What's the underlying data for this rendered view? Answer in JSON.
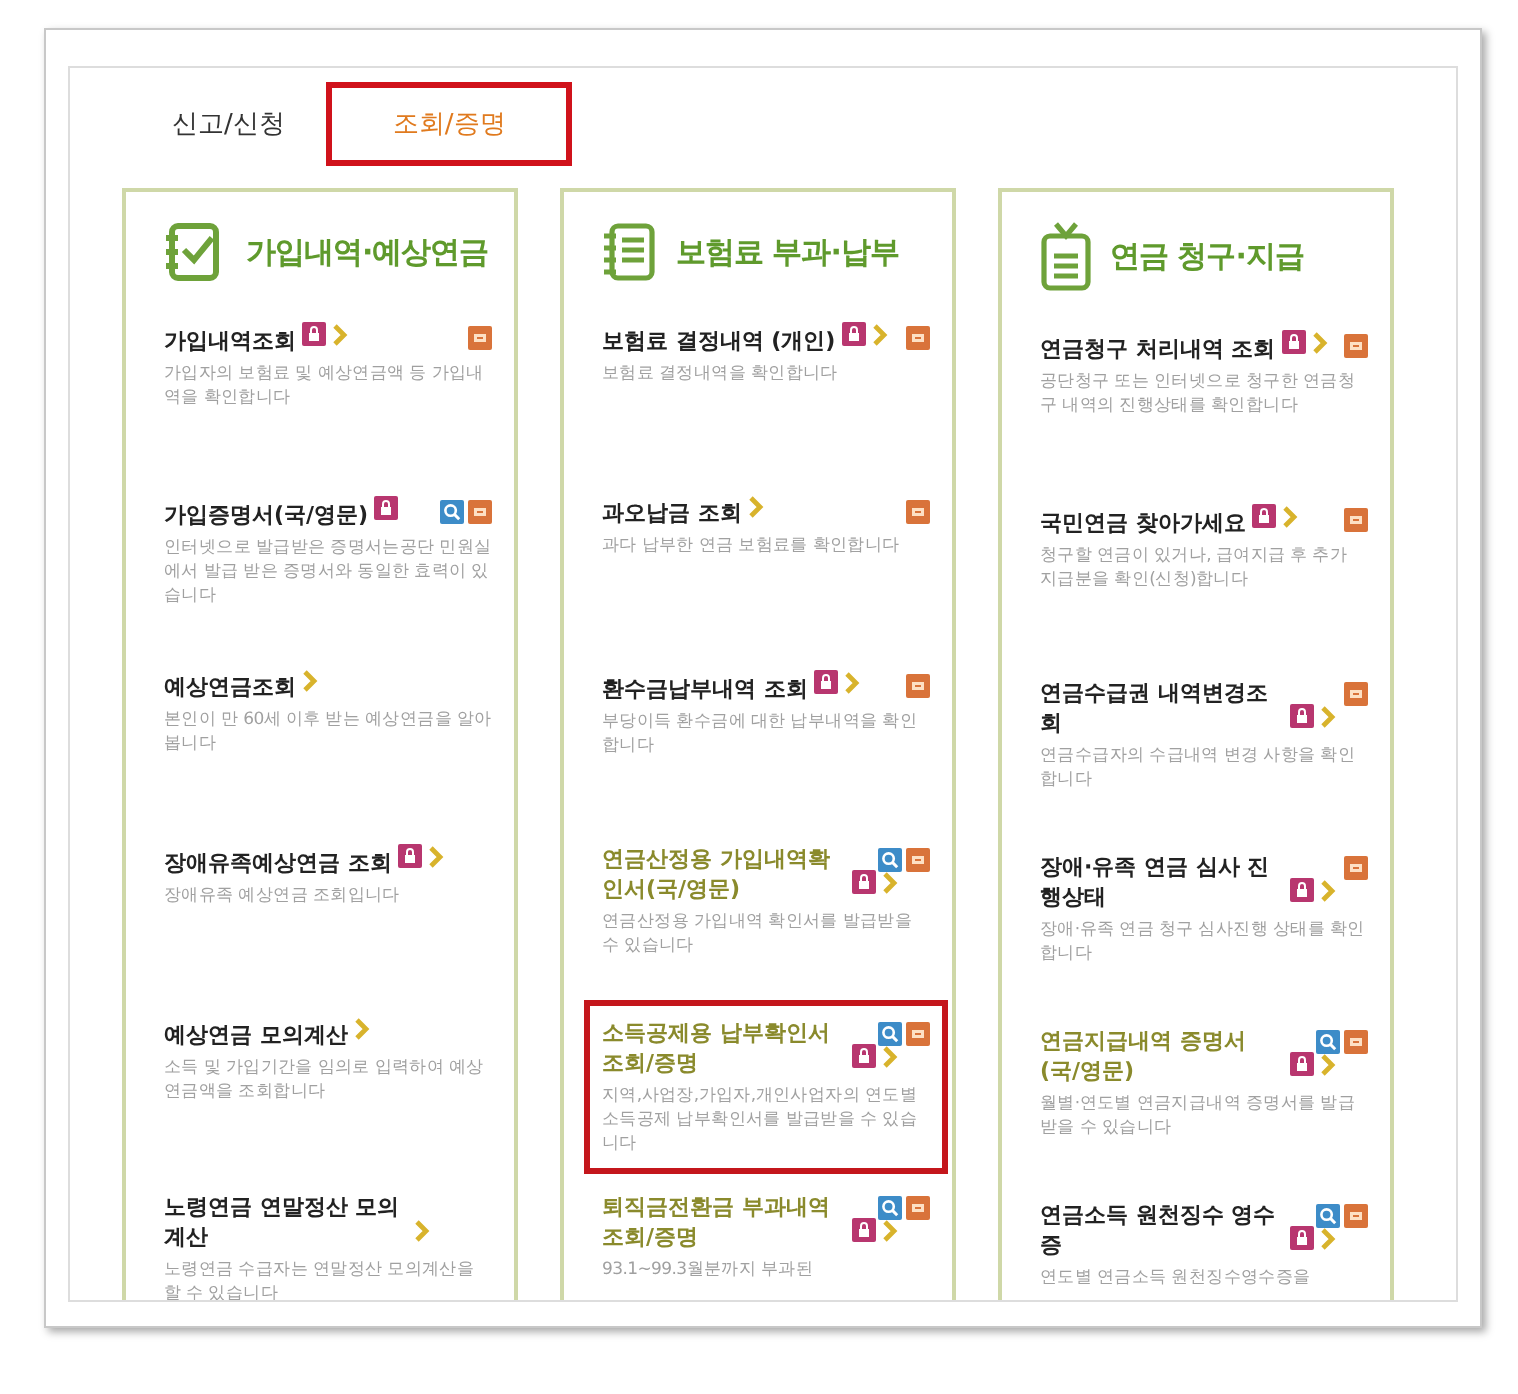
{
  "tabs": [
    {
      "label": "신고/신청",
      "selected": false
    },
    {
      "label": "조회/증명",
      "selected": true
    }
  ],
  "columns": [
    {
      "title": "가입내역·예상연금",
      "kind": "checklist",
      "items": [
        {
          "title": "가입내역조회",
          "description": "가입자의 보험료 및 예상연금액 등 가입내역을 확인합니다",
          "lock": true,
          "arrow": true,
          "search": false,
          "print": true,
          "visited": false,
          "highlighted": false
        },
        {
          "title": "가입증명서(국/영문)",
          "description": "인터넷으로 발급받은 증명서는공단 민원실에서 발급 받은 증명서와 동일한 효력이 있습니다",
          "lock": true,
          "arrow": false,
          "search": true,
          "print": true,
          "visited": false,
          "highlighted": false
        },
        {
          "title": "예상연금조회",
          "description": "본인이 만 60세 이후 받는 예상연금을 알아봅니다",
          "lock": false,
          "arrow": true,
          "search": false,
          "print": false,
          "visited": false,
          "highlighted": false
        },
        {
          "title": "장애유족예상연금 조회",
          "description": "장애유족 예상연금 조회입니다",
          "lock": true,
          "arrow": true,
          "search": false,
          "print": false,
          "visited": false,
          "highlighted": false
        },
        {
          "title": "예상연금 모의계산",
          "description": "소득 및 가입기간을 임의로 입력하여 예상연금액을 조회합니다",
          "lock": false,
          "arrow": true,
          "search": false,
          "print": false,
          "visited": false,
          "highlighted": false
        },
        {
          "title": "노령연금 연말정산 모의계산",
          "description": "노령연금 수급자는 연말정산 모의계산을 할 수 있습니다",
          "lock": false,
          "arrow": true,
          "search": false,
          "print": false,
          "visited": false,
          "highlighted": false
        }
      ]
    },
    {
      "title": "보험료 부과·납부",
      "kind": "notebook",
      "items": [
        {
          "title": "보험료 결정내역 (개인)",
          "description": "보험료 결정내역을 확인합니다",
          "lock": true,
          "arrow": true,
          "search": false,
          "print": true,
          "visited": false,
          "highlighted": false
        },
        {
          "title": "과오납금 조회",
          "description": "과다 납부한 연금 보험료를 확인합니다",
          "lock": false,
          "arrow": true,
          "search": false,
          "print": true,
          "visited": false,
          "highlighted": false
        },
        {
          "title": "환수금납부내역 조회",
          "description": "부당이득 환수금에 대한 납부내역을 확인합니다",
          "lock": true,
          "arrow": true,
          "search": false,
          "print": true,
          "visited": false,
          "highlighted": false
        },
        {
          "title": "연금산정용 가입내역확인서(국/영문)",
          "description": "연금산정용 가입내역 확인서를 발급받을 수 있습니다",
          "lock": true,
          "arrow": true,
          "search": true,
          "print": true,
          "visited": true,
          "highlighted": false
        },
        {
          "title": "소득공제용 납부확인서 조회/증명",
          "description": "지역,사업장,가입자,개인사업자의 연도별 소득공제 납부확인서를 발급받을 수 있습니다",
          "lock": true,
          "arrow": true,
          "search": true,
          "print": true,
          "visited": true,
          "highlighted": true
        },
        {
          "title": "퇴직금전환금 부과내역 조회/증명",
          "description": "93.1~99.3월분까지 부과된",
          "lock": true,
          "arrow": true,
          "search": true,
          "print": true,
          "visited": true,
          "highlighted": false
        }
      ]
    },
    {
      "title": "연금 청구·지급",
      "kind": "tag",
      "items": [
        {
          "title": "연금청구 처리내역 조회",
          "description": "공단청구 또는 인터넷으로 청구한 연금청구 내역의 진행상태를 확인합니다",
          "lock": true,
          "arrow": true,
          "search": false,
          "print": true,
          "visited": false,
          "highlighted": false
        },
        {
          "title": "국민연금 찾아가세요",
          "description": "청구할 연금이 있거나, 급여지급 후 추가 지급분을 확인(신청)합니다",
          "lock": true,
          "arrow": true,
          "search": false,
          "print": true,
          "visited": false,
          "highlighted": false
        },
        {
          "title": "연금수급권 내역변경조회",
          "description": "연금수급자의 수급내역 변경 사항을 확인합니다",
          "lock": true,
          "arrow": true,
          "search": false,
          "print": true,
          "visited": false,
          "highlighted": false
        },
        {
          "title": "장애·유족 연금 심사 진행상태",
          "description": "장애·유족 연금 청구 심사진행 상태를 확인합니다",
          "lock": true,
          "arrow": true,
          "search": false,
          "print": true,
          "visited": false,
          "highlighted": false
        },
        {
          "title": "연금지급내역 증명서 (국/영문)",
          "description": "월별·연도별 연금지급내역 증명서를 발급 받을 수 있습니다",
          "lock": true,
          "arrow": true,
          "search": true,
          "print": true,
          "visited": true,
          "highlighted": false
        },
        {
          "title": "연금소득 원천징수 영수증",
          "description": "연도별 연금소득 원천징수영수증을",
          "lock": true,
          "arrow": true,
          "search": true,
          "print": true,
          "visited": false,
          "highlighted": false
        }
      ]
    }
  ]
}
